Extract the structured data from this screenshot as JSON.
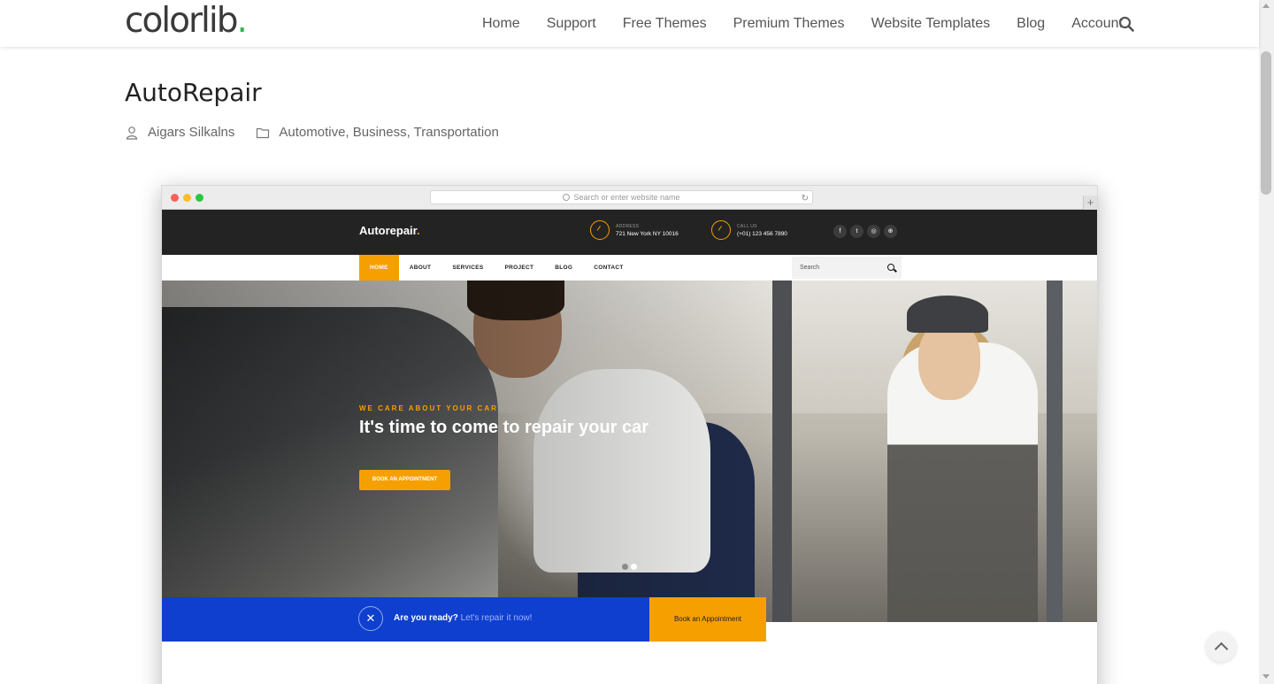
{
  "header": {
    "logo_text": "colorlib",
    "logo_dot": ".",
    "logo_dot_color": "#34b34e",
    "nav": [
      {
        "label": "Home"
      },
      {
        "label": "Support"
      },
      {
        "label": "Free Themes"
      },
      {
        "label": "Premium Themes"
      },
      {
        "label": "Website Templates"
      },
      {
        "label": "Blog"
      },
      {
        "label": "Account"
      }
    ],
    "search_icon": "search-icon"
  },
  "post": {
    "title": "AutoRepair",
    "author": "Aigars Silkalns",
    "author_icon": "user-icon",
    "categories": "Automotive, Business, Transportation",
    "categories_icon": "folder-icon"
  },
  "mockup": {
    "url_placeholder": "Search or enter website name",
    "traffic_lights": [
      "#ff5f57",
      "#febc2e",
      "#28c840"
    ],
    "plus_label": "+",
    "site": {
      "brand": "Autorepair",
      "brand_dot": ".",
      "address_label": "ADDRESS",
      "address_value": "721 New York NY 10016",
      "call_label": "CALL US",
      "call_value": "(+01) 123 456 7890",
      "social": [
        "f",
        "t",
        "◎",
        "⊕"
      ],
      "nav": [
        {
          "label": "HOME",
          "active": true
        },
        {
          "label": "ABOUT",
          "active": false
        },
        {
          "label": "SERVICES",
          "active": false
        },
        {
          "label": "PROJECT",
          "active": false
        },
        {
          "label": "BLOG",
          "active": false
        },
        {
          "label": "CONTACT",
          "active": false
        }
      ],
      "search_placeholder": "Search",
      "hero_pretitle": "WE CARE ABOUT YOUR CAR",
      "hero_title": "It's time to come to repair your car",
      "hero_button": "BOOK AN APPOINTMENT",
      "strip_text": "Are you ready?",
      "strip_alt_text": "Let's repair it now!",
      "strip_button": "Book an Appointment",
      "accent_color": "#f5a000",
      "strip_color": "#0f3fcf"
    }
  },
  "colors": {
    "nav_text": "#555555",
    "title": "#222222"
  }
}
